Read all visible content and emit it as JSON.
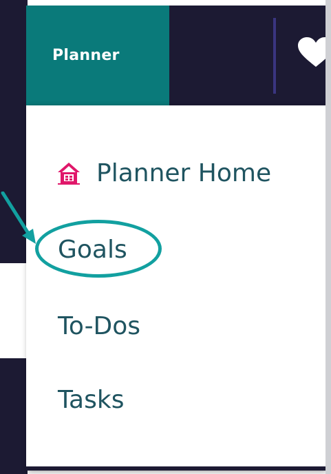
{
  "navbar": {
    "active_tab": "Planner",
    "heart_icon": "heart-icon",
    "colors": {
      "bar": "#1c1a33",
      "active_tab": "#0a7a7a",
      "divider": "#3a3580"
    }
  },
  "dropdown": {
    "items": [
      {
        "label": "Planner Home",
        "icon": "house-icon",
        "icon_color": "#e0176a"
      },
      {
        "label": "Goals",
        "highlighted": true
      },
      {
        "label": "To-Dos"
      },
      {
        "label": "Tasks"
      }
    ],
    "text_color": "#1f5460"
  },
  "annotation": {
    "color": "#12a0a0",
    "target": "Goals"
  }
}
